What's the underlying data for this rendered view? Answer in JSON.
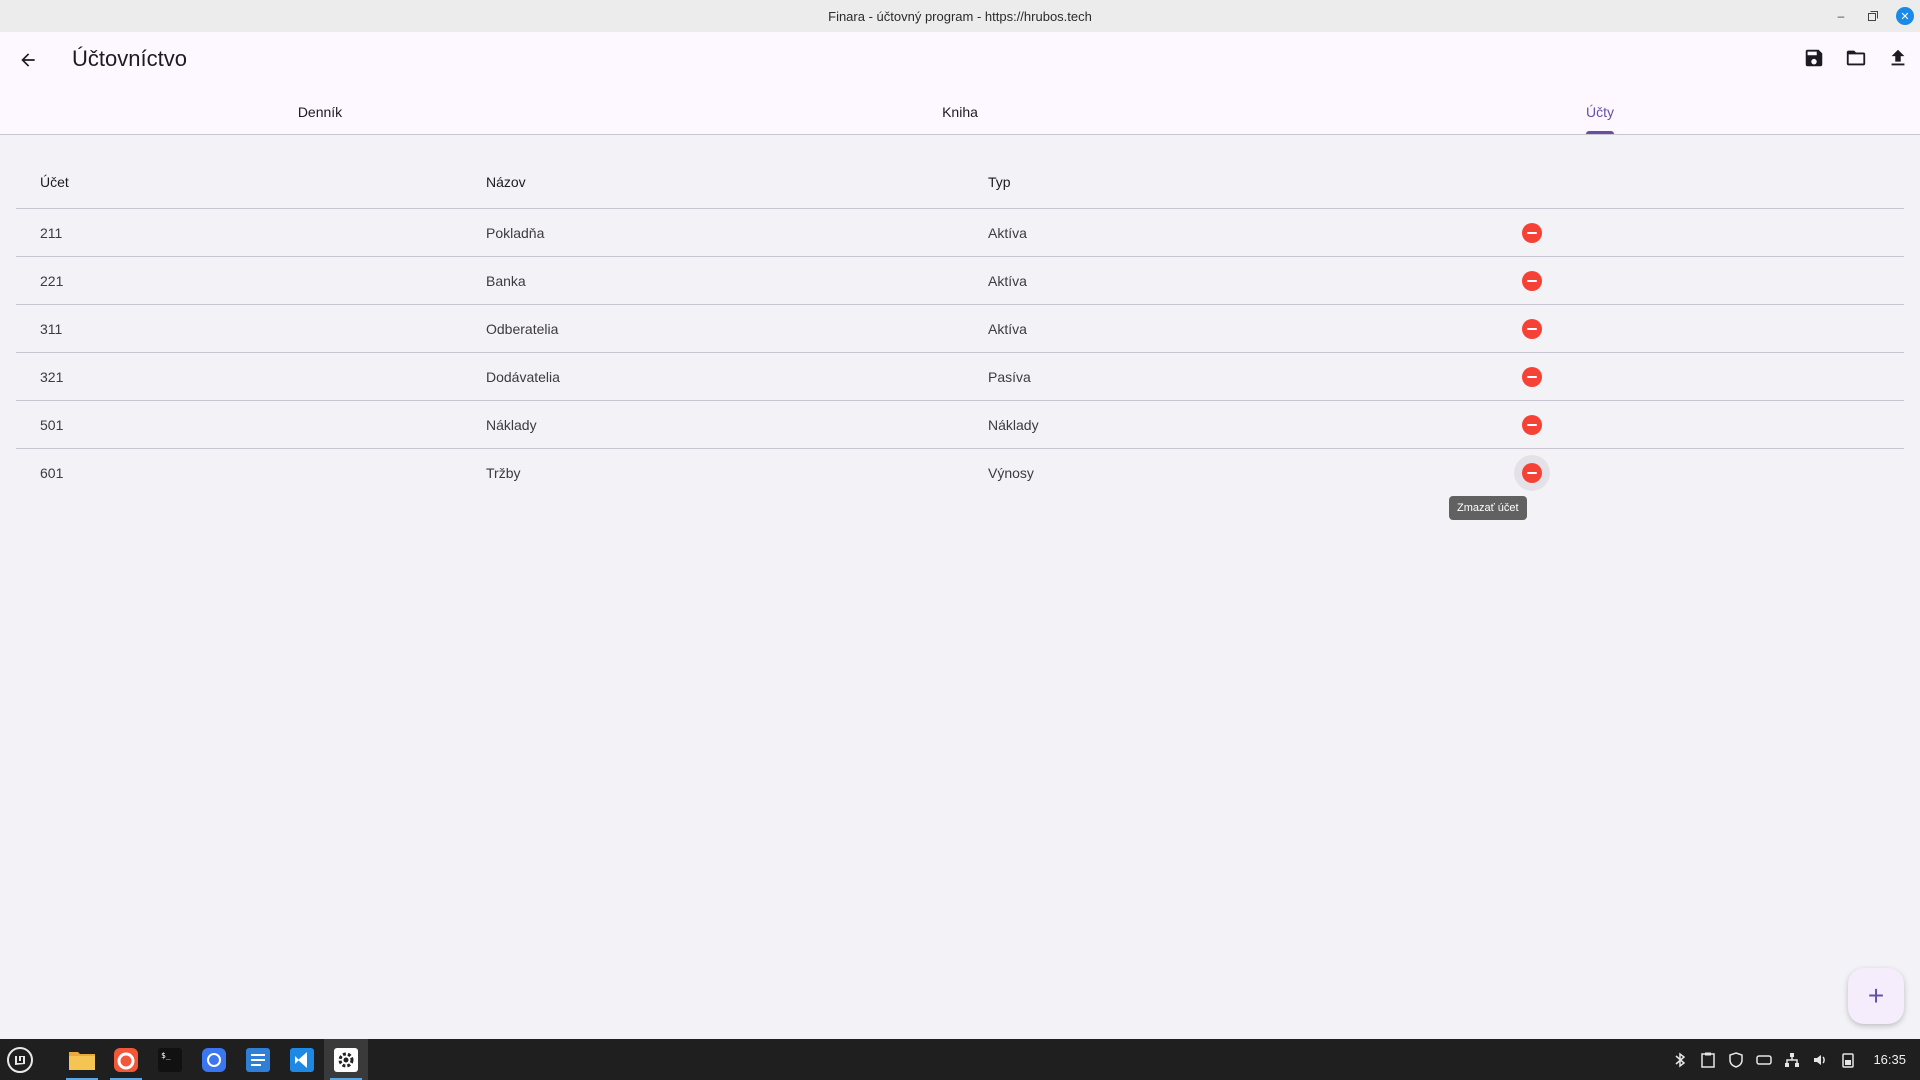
{
  "window": {
    "title": "Finara - účtovný program - https://hrubos.tech"
  },
  "appbar": {
    "title": "Účtovníctvo"
  },
  "tabs": [
    {
      "label": "Denník",
      "active": false
    },
    {
      "label": "Kniha",
      "active": false
    },
    {
      "label": "Účty",
      "active": true
    }
  ],
  "table": {
    "headers": {
      "account": "Účet",
      "name": "Názov",
      "type": "Typ"
    },
    "rows": [
      {
        "account": "211",
        "name": "Pokladňa",
        "type": "Aktíva"
      },
      {
        "account": "221",
        "name": "Banka",
        "type": "Aktíva"
      },
      {
        "account": "311",
        "name": "Odberatelia",
        "type": "Aktíva"
      },
      {
        "account": "321",
        "name": "Dodávatelia",
        "type": "Pasíva"
      },
      {
        "account": "501",
        "name": "Náklady",
        "type": "Náklady"
      },
      {
        "account": "601",
        "name": "Tržby",
        "type": "Výnosy"
      }
    ]
  },
  "tooltip": "Zmazať účet",
  "fab": {
    "label": "+"
  },
  "taskbar": {
    "apps": [
      "files-icon",
      "firefox-icon",
      "terminal-icon",
      "signal-icon",
      "text-editor-icon",
      "vscode-icon",
      "settings-icon"
    ],
    "clock": "16:35"
  },
  "colors": {
    "accent": "#6750a4",
    "delete": "#f44336",
    "appbar_bg": "#fdf7ff",
    "page_bg": "#f3f3f7"
  }
}
